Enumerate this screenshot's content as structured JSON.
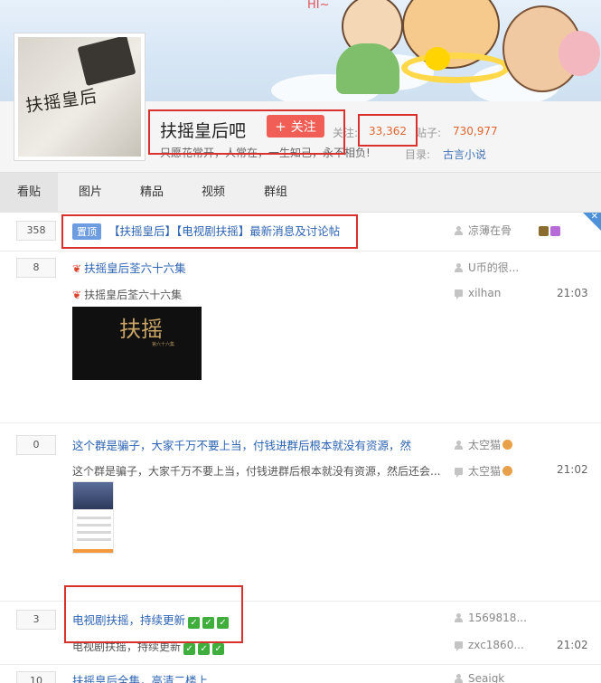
{
  "forum": {
    "name": "扶摇皇后吧",
    "follow_label": "关注",
    "slogan": "只愿花常开，人常在，一生知己，永不相负!",
    "followers_label": "关注:",
    "followers": "33,362",
    "posts_label": "贴子:",
    "posts": "730,977",
    "category_label": "目录:",
    "category": "古言小说",
    "avatar_text": "扶摇皇后",
    "banner_text": "HI~"
  },
  "tabs": [
    "看贴",
    "图片",
    "精品",
    "视频",
    "群组"
  ],
  "threads": [
    {
      "replies": "358",
      "pinned_label": "置顶",
      "title": "【扶摇皇后】【电视剧扶摇】最新消息及讨论帖",
      "author": "凉薄在骨"
    },
    {
      "replies": "8",
      "title": "扶摇皇后荃六十六集",
      "author": "U币的很...",
      "excerpt": "扶摇皇后荃六十六集",
      "last_reply": "xilhan",
      "time": "21:03",
      "image_text": "扶摇",
      "image_subtext": "第六十六集"
    },
    {
      "replies": "0",
      "title": "这个群是骗子，大家千万不要上当，付钱进群后根本就没有资源，然",
      "author": "太空猫",
      "excerpt": "这个群是骗子，大家千万不要上当，付钱进群后根本就没有资源，然后还会...",
      "last_reply": "太空猫",
      "time": "21:02"
    },
    {
      "replies": "3",
      "title": "电视剧扶摇，持续更新",
      "author": "1569818...",
      "excerpt": "电视剧扶摇，持续更新",
      "last_reply": "zxc1860...",
      "time": "21:02"
    },
    {
      "replies": "10",
      "title": "扶摇皇后全集，高清二楼上",
      "author": "Seaigk"
    }
  ],
  "colors": {
    "accent_red": "#f15e55",
    "link_blue": "#2d64b3",
    "stat_orange": "#e16531",
    "annotation_red": "#d9312e"
  },
  "icons": [
    "person-icon",
    "chat-icon",
    "check-icon",
    "leaf-icon",
    "close-icon",
    "plus-icon"
  ]
}
